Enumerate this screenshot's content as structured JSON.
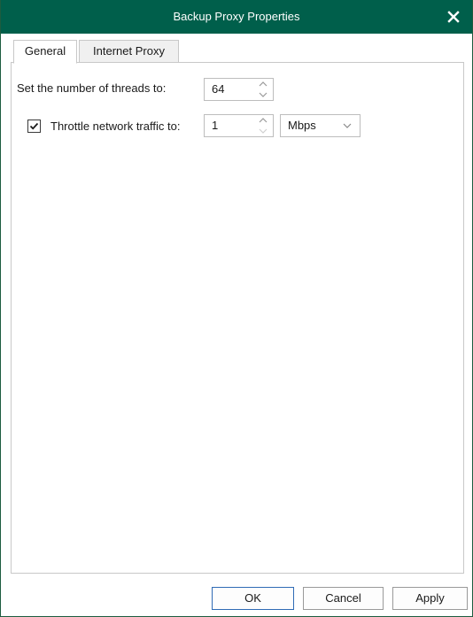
{
  "window": {
    "title": "Backup Proxy Properties"
  },
  "tabs": [
    {
      "label": "General",
      "active": true
    },
    {
      "label": "Internet Proxy",
      "active": false
    }
  ],
  "general": {
    "threads_label": "Set the number of threads to:",
    "threads_value": "64",
    "throttle_checked": true,
    "throttle_label": "Throttle network traffic to:",
    "throttle_value": "1",
    "unit_selected": "Mbps"
  },
  "buttons": {
    "ok": "OK",
    "cancel": "Cancel",
    "apply": "Apply"
  },
  "colors": {
    "titlebar": "#005f4b",
    "accent_border": "#2f6bb5"
  },
  "icons": {
    "close": "close-icon",
    "spinner_up": "chevron-up-icon",
    "spinner_down": "chevron-down-icon",
    "dropdown": "chevron-down-icon",
    "checkmark": "checkmark-icon"
  }
}
